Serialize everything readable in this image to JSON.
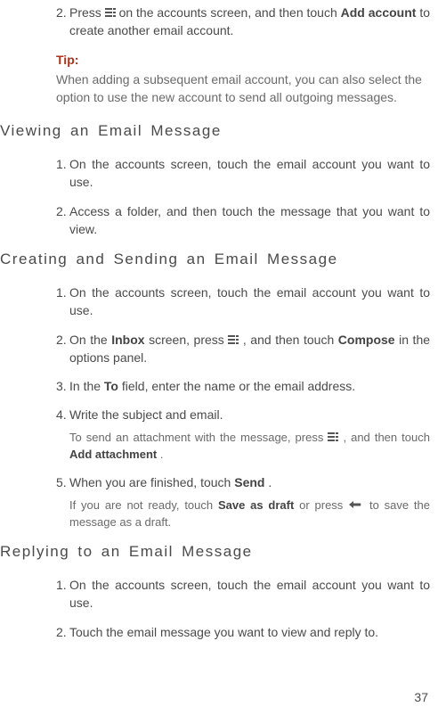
{
  "top_step": {
    "num": "2.",
    "pre": "Press ",
    "mid": " on the accounts screen, and then touch ",
    "bold": "Add account",
    "post": " to create another email account."
  },
  "tip": {
    "head": "Tip:",
    "body": "When adding a subsequent email account, you can also select the option to use the new account to send all outgoing messages."
  },
  "viewing": {
    "title": "Viewing an Email Message",
    "s1": {
      "num": "1.",
      "text": "On the accounts screen, touch the email account you want to use."
    },
    "s2": {
      "num": "2.",
      "text": "Access a folder, and then touch the message that you want to view."
    }
  },
  "creating": {
    "title": "Creating and Sending an Email Message",
    "s1": {
      "num": "1.",
      "text": "On the accounts screen, touch the email account you want to use."
    },
    "s2": {
      "num": "2.",
      "a": "On the ",
      "b": "Inbox",
      "c": " screen, press ",
      "d": " , and then touch ",
      "e": "Compose",
      "f": " in the options panel."
    },
    "s3": {
      "num": "3.",
      "a": "In the ",
      "b": "To",
      "c": " field, enter the name or the email address."
    },
    "s4": {
      "num": "4.",
      "text": "Write the subject and email.",
      "note_a": "To send an attachment with the message,  press ",
      "note_b": " , and then touch ",
      "note_bold": "Add attachment",
      "note_c": "."
    },
    "s5": {
      "num": "5.",
      "a": "When you are finished, touch ",
      "b": "Send",
      "c": ".",
      "note_a": "If you are not ready, touch ",
      "note_b1": "Save as draft",
      "note_mid": " or press ",
      "note_c": " to save the message as a draft."
    }
  },
  "replying": {
    "title": "Replying to an Email Message",
    "s1": {
      "num": "1.",
      "text": "On the accounts screen, touch the email account you want to use."
    },
    "s2": {
      "num": "2.",
      "text": "Touch the email message you want to view and reply to."
    }
  },
  "page_num": "37"
}
